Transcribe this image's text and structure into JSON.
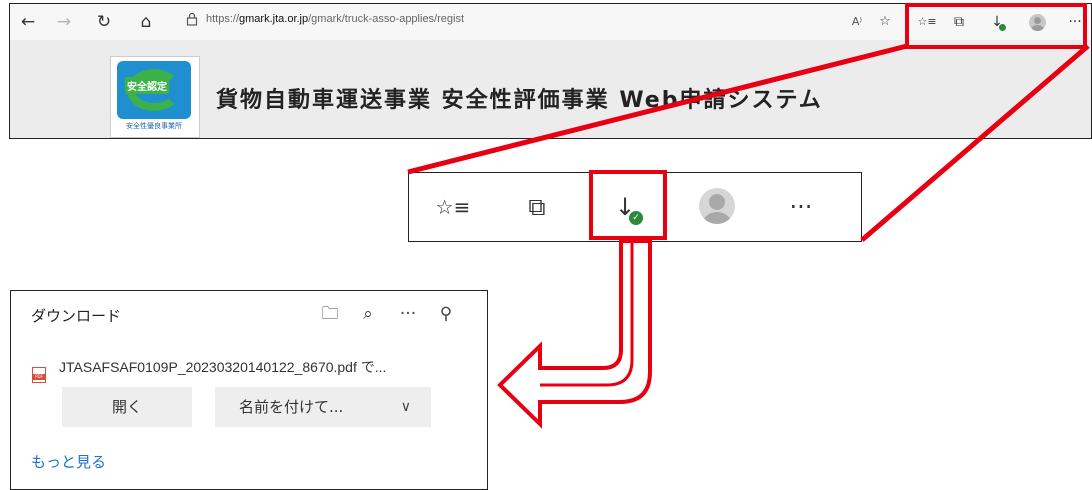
{
  "browser": {
    "nav": {
      "back_icon": "←",
      "forward_icon": "→",
      "refresh_icon": "↻",
      "home_icon": "⌂",
      "lock_icon": "🔒"
    },
    "url_prefix": "https://",
    "url_domain": "gmark.jta.or.jp",
    "url_path": "/gmark/truck-asso-applies/regist",
    "toolbar_icons": {
      "read_aloud": "A⁾",
      "add_favorite": "☆",
      "favorites": "☆≡",
      "collections": "⧉",
      "downloads": "↓",
      "more": "···"
    }
  },
  "page": {
    "logo_top_text": "安全認定",
    "logo_bottom_text": "安全性優良事業所",
    "title": "貨物自動車運送事業 安全性評価事業 Web申請システム"
  },
  "zoom_toolbar": {
    "favorites_icon": "☆≡",
    "collections_icon": "⧉",
    "downloads_icon": "↓",
    "more_icon": "···"
  },
  "download_panel": {
    "title": "ダウンロード",
    "folder_icon": "🗀",
    "search_icon": "⌕",
    "more_icon": "···",
    "pin_icon": "⚲",
    "pdf_label": "PDF",
    "file_name": "JTASAFSAF0109P_20230320140122_8670.pdf で...",
    "open_button": "開く",
    "save_as_button": "名前を付けて...",
    "chevron": "∨",
    "more_link": "もっと見る"
  },
  "colors": {
    "highlight": "#e60012",
    "link": "#1a73c8",
    "check": "#2c8a3a"
  }
}
